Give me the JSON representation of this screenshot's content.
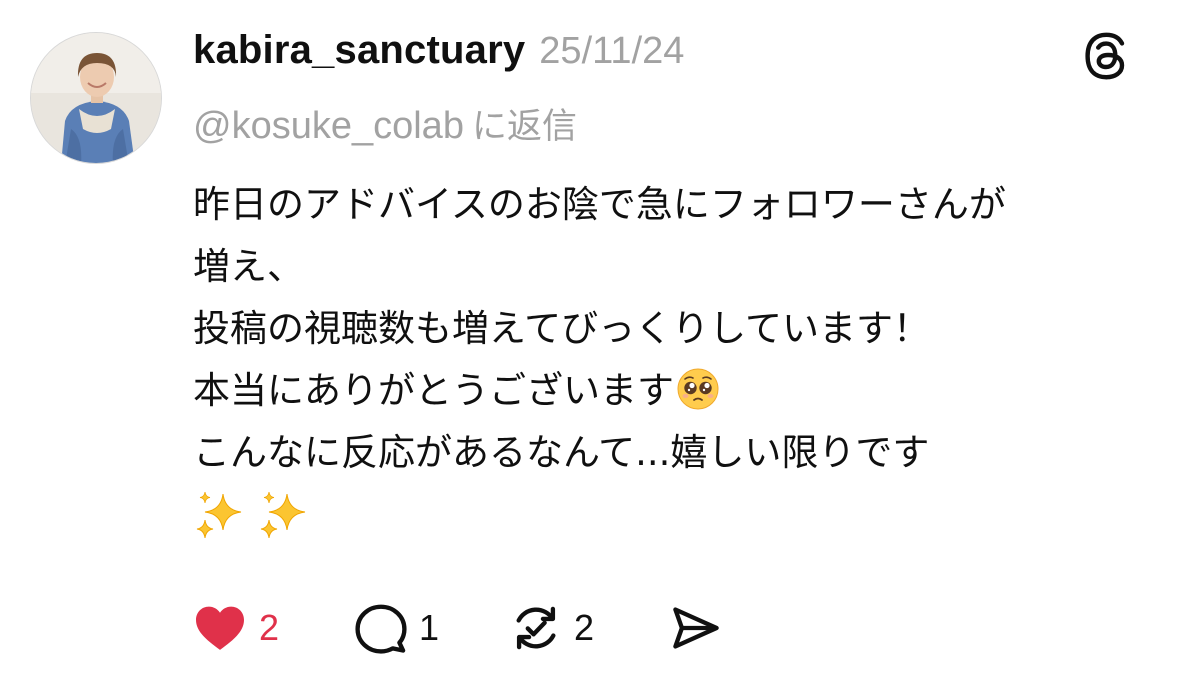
{
  "post": {
    "username": "kabira_sanctuary",
    "timestamp": "25/11/24",
    "reply_to_handle": "@kosuke_colab",
    "reply_to_suffix": "に返信",
    "body_lines": [
      "昨日のアドバイスのお陰で急にフォロワーさんが",
      "増え、",
      "投稿の視聴数も増えてびっくりしています！",
      "本当にありがとうございます",
      "こんなに反応があるなんて...嬉しい限りです"
    ],
    "emojis": [
      "pleading-face",
      "sparkles",
      "sparkles"
    ]
  },
  "actions": {
    "like": {
      "count": "2",
      "liked": true,
      "icon": "heart-icon"
    },
    "comment": {
      "count": "1",
      "icon": "comment-icon"
    },
    "repost": {
      "count": "2",
      "icon": "repost-icon"
    },
    "share": {
      "icon": "send-icon"
    }
  },
  "app": {
    "logo": "threads-logo-icon"
  },
  "colors": {
    "text": "#101010",
    "muted": "#a2a2a2",
    "like": "#e0314a"
  }
}
